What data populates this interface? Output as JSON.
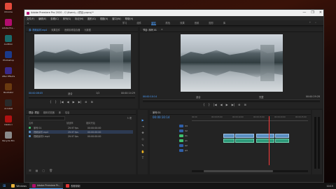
{
  "desktop_icons": [
    {
      "label": "Chrome",
      "color": "#e24a3b"
    },
    {
      "label": "Adobe Pre...",
      "color": "#b10d6e"
    },
    {
      "label": "Audition",
      "color": "#1a6a6a"
    },
    {
      "label": "Photoshop",
      "color": "#1b3a8a"
    },
    {
      "label": "After Effects",
      "color": "#3a2a8a"
    },
    {
      "label": "Illustrator",
      "color": "#6a3a10"
    },
    {
      "label": "Acrobat",
      "color": "#2a2a2a"
    },
    {
      "label": "DaVinci",
      "color": "#b11111"
    },
    {
      "label": "Recycle Bin",
      "color": "#8a8a8a"
    }
  ],
  "app": {
    "title": "Adobe Premiere Pro 2020 - C:\\Users\\...\\项目.prproj *",
    "window_buttons": [
      "—",
      "❐",
      "✕"
    ],
    "menu": [
      "文件(F)",
      "编辑(E)",
      "剪辑(C)",
      "序列(S)",
      "标记(M)",
      "图形(G)",
      "视图(V)",
      "窗口(W)",
      "帮助(H)"
    ],
    "workspaces": [
      "学习",
      "组件",
      "编辑",
      "颜色",
      "效果",
      "音频",
      "图形",
      "库"
    ],
    "active_workspace": "编辑"
  },
  "source_monitor": {
    "tabs": [
      "源: 视频素材.mp4",
      "效果控件",
      "音频剪辑混合器",
      "元数据"
    ],
    "timecode": "00:00:08:05",
    "fit": "适合",
    "quality": "1/2",
    "duration": "00:00:14:29",
    "controls": [
      "{",
      "}",
      "|◀",
      "◀",
      "▶",
      "▶|",
      "⊕",
      "⊞"
    ]
  },
  "program_monitor": {
    "tabs": [
      "节目: 序列 01",
      "≡"
    ],
    "timecode": "00:00:10:14",
    "fit": "适合",
    "quality": "完整",
    "duration": "00:00:29:28",
    "controls": [
      "{",
      "}",
      "|◀",
      "◀",
      "▶",
      "▶|",
      "⊕",
      "⊞"
    ]
  },
  "project_panel": {
    "tabs": [
      "项目: 项目",
      "媒体浏览器",
      "库",
      "信息"
    ],
    "count": "3 项",
    "columns": [
      "名称",
      "帧速率",
      "媒体开始"
    ],
    "items": [
      {
        "name": "序列 01",
        "fps": "29.97 fps",
        "start": "00:00:00:00",
        "color": "#3fbf6f"
      },
      {
        "name": "视频素材.mp4",
        "fps": "29.97 fps",
        "start": "00:00:00:00",
        "color": "#5a8fc2"
      },
      {
        "name": "视频素材2.mp4",
        "fps": "29.97 fps",
        "start": "00:00:00:00",
        "color": "#5a8fc2"
      }
    ]
  },
  "timeline": {
    "tab": "序列 01",
    "timecode": "00:00:10:14",
    "ruler": [
      "00:00",
      "00:00:05:00",
      "00:00:10:00",
      "00:00:15:00",
      "00:00:20:00",
      "00:00:25:00"
    ],
    "video_tracks": [
      "V3",
      "V2",
      "V1"
    ],
    "audio_tracks": [
      "A1",
      "A2",
      "A3"
    ],
    "clips": [
      "视频素材.mp4",
      "视频素材.mp4",
      "视频素材.mp4",
      "视频素材.mp4"
    ]
  },
  "tools": [
    "▶",
    "⇥",
    "✥",
    "◇",
    "✎",
    "✋",
    "T"
  ],
  "taskbar": {
    "items": [
      "⊞",
      "Windows",
      "Adobe Premiere Pr...",
      "视频录制"
    ],
    "active": "Adobe Premiere Pr...",
    "clock": "10:15"
  }
}
